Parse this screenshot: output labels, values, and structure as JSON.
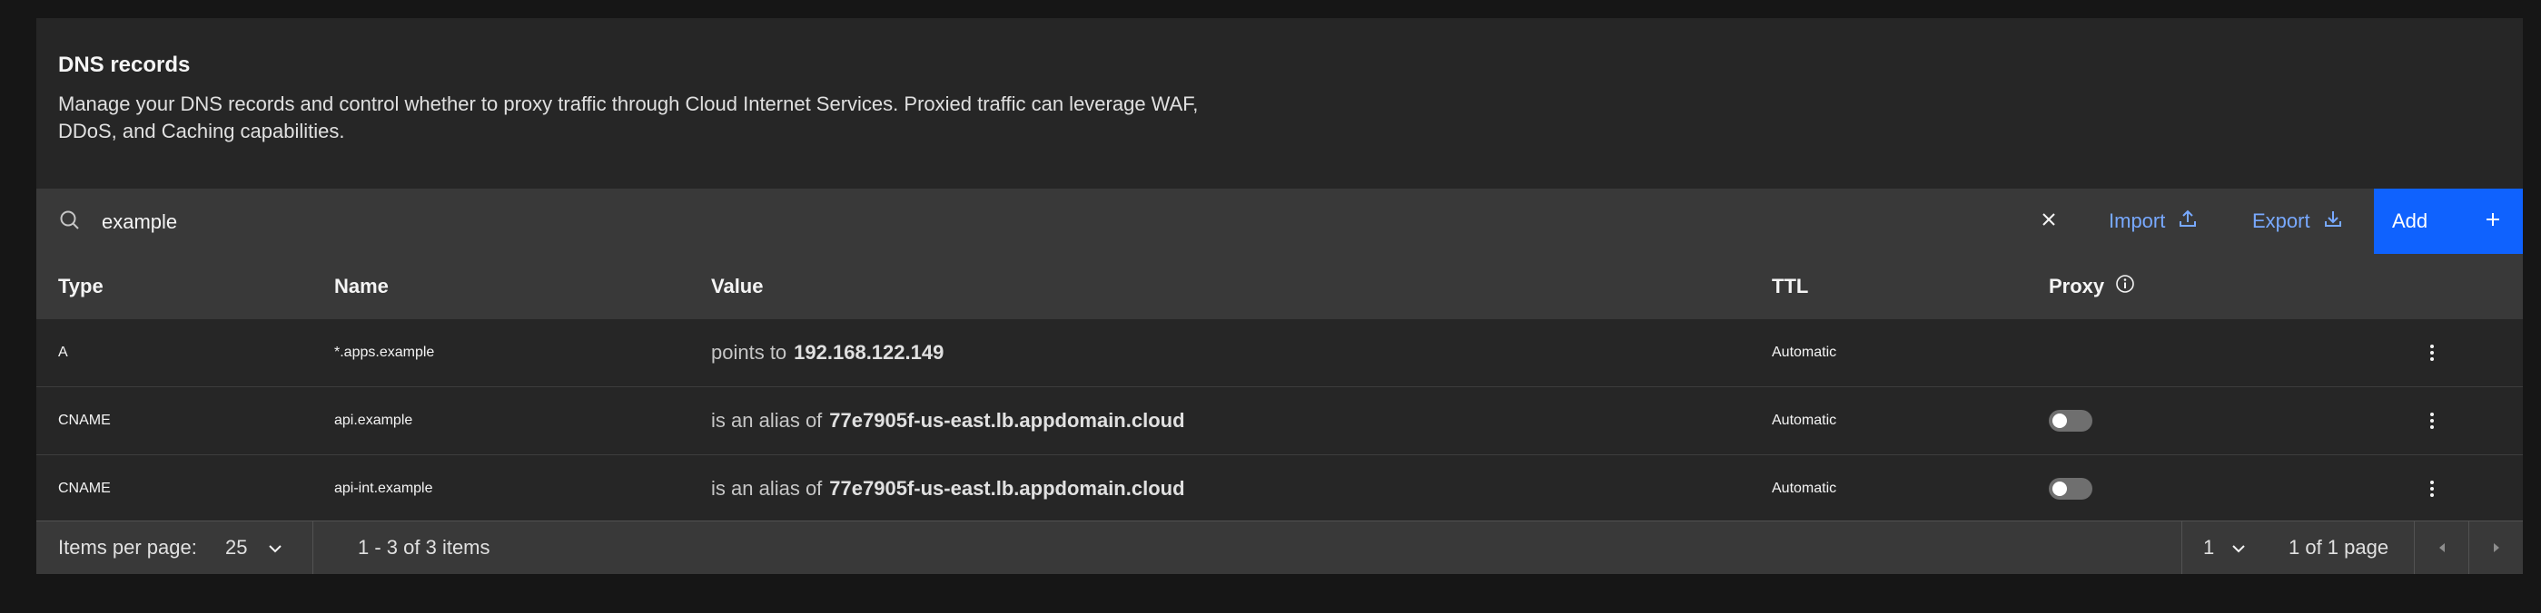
{
  "header": {
    "title": "DNS records",
    "description_line1": "Manage your DNS records and control whether to proxy traffic through Cloud Internet Services. Proxied traffic can leverage WAF,",
    "description_line2": "DDoS, and Caching capabilities."
  },
  "toolbar": {
    "search_value": "example",
    "search_icon": "search-icon",
    "clear_icon": "close-icon",
    "import_label": "Import",
    "import_icon": "upload-icon",
    "export_label": "Export",
    "export_icon": "download-icon",
    "add_label": "Add",
    "add_icon": "plus-icon"
  },
  "table": {
    "columns": [
      "Type",
      "Name",
      "Value",
      "TTL",
      "Proxy"
    ],
    "proxy_info_icon": "info-icon",
    "rows": [
      {
        "type": "A",
        "name": "*.apps.example",
        "value_prefix": "points to",
        "value": "192.168.122.149",
        "ttl": "Automatic",
        "proxy": null
      },
      {
        "type": "CNAME",
        "name": "api.example",
        "value_prefix": "is an alias of",
        "value": "77e7905f-us-east.lb.appdomain.cloud",
        "ttl": "Automatic",
        "proxy": false
      },
      {
        "type": "CNAME",
        "name": "api-int.example",
        "value_prefix": "is an alias of",
        "value": "77e7905f-us-east.lb.appdomain.cloud",
        "ttl": "Automatic",
        "proxy": false
      }
    ]
  },
  "pagination": {
    "items_per_page_label": "Items per page:",
    "items_per_page_value": "25",
    "range_text": "1 - 3 of 3 items",
    "page_value": "1",
    "page_of_text": "1 of 1 page"
  },
  "colors": {
    "background": "#161616",
    "panel": "#262626",
    "toolbar": "#393939",
    "accent": "#0f62fe",
    "link": "#78a9ff"
  }
}
